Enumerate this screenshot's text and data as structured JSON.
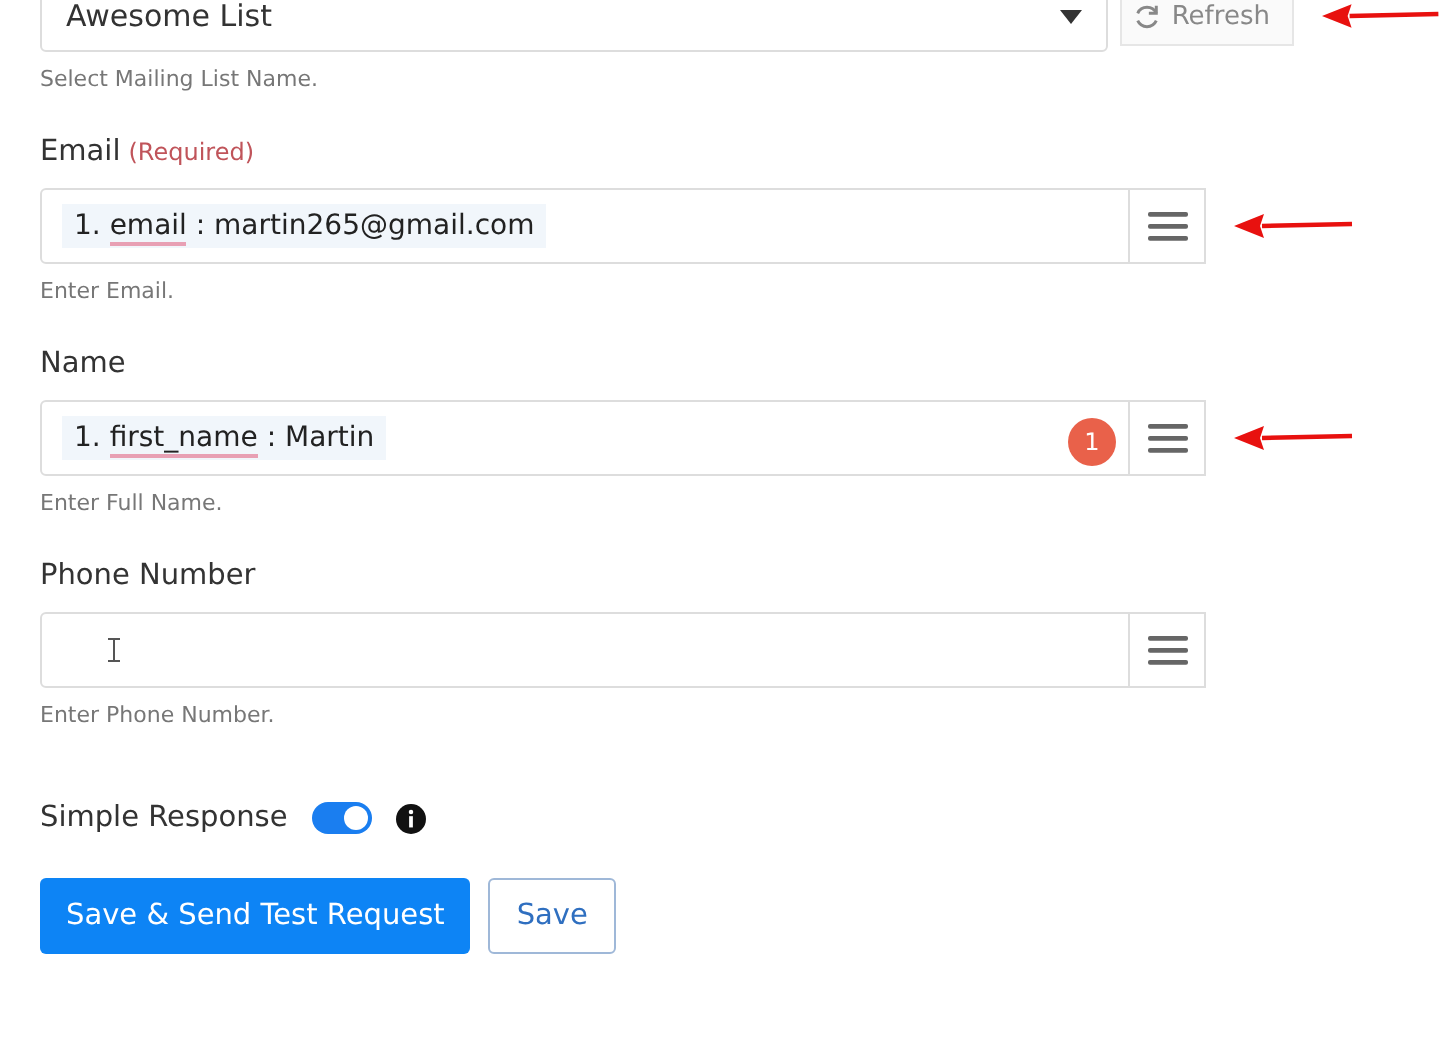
{
  "mailing_list": {
    "value": "Awesome List",
    "refresh_label": "Refresh",
    "hint": "Select Mailing List Name.",
    "annotated": true
  },
  "fields": [
    {
      "label": "Email",
      "required_note": "(Required)",
      "tag": {
        "index": "1.",
        "key": "email",
        "sep": ":",
        "value": "martin265@gmail.com"
      },
      "hint": "Enter Email.",
      "annotated": true,
      "cursor": false
    },
    {
      "label": "Name",
      "tag": {
        "index": "1.",
        "key": "first_name",
        "sep": ":",
        "value": "Martin"
      },
      "badge": "1",
      "hint": "Enter Full Name.",
      "annotated": true,
      "cursor": false
    },
    {
      "label": "Phone Number",
      "hint": "Enter Phone Number.",
      "annotated": false,
      "cursor": true
    }
  ],
  "simple_response": {
    "label": "Simple Response",
    "on": true
  },
  "buttons": [
    {
      "label": "Save & Send Test Request",
      "kind": "primary"
    },
    {
      "label": "Save",
      "kind": "outline"
    }
  ]
}
